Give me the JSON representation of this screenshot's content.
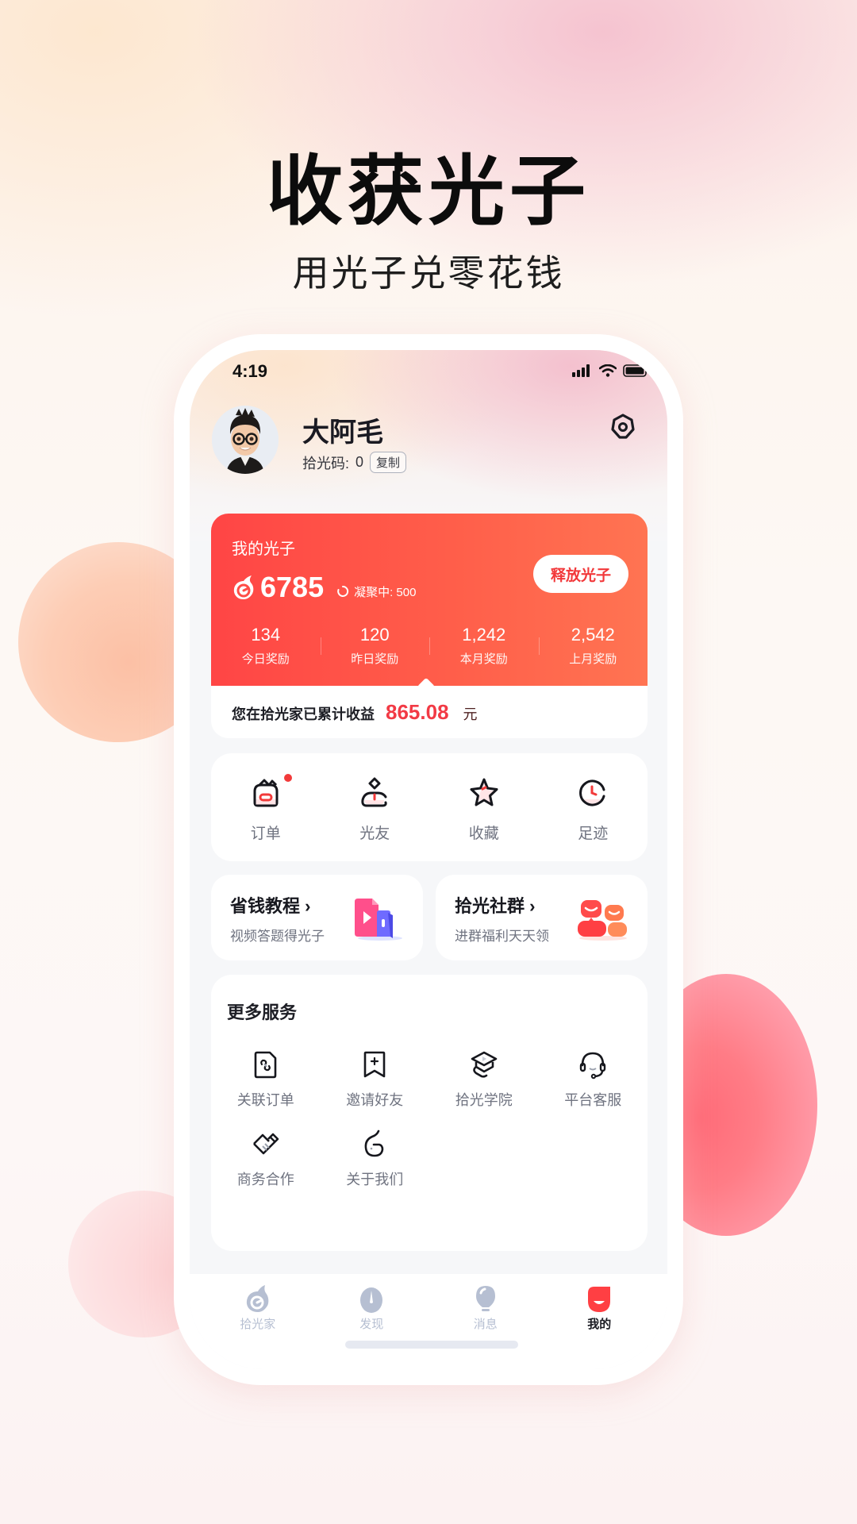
{
  "hero": {
    "title": "收获光子",
    "subtitle": "用光子兑零花钱"
  },
  "status_bar": {
    "time": "4:19",
    "icons": [
      "signal-icon",
      "wifi-icon",
      "battery-icon"
    ]
  },
  "profile": {
    "name": "大阿毛",
    "code_label": "拾光码:",
    "code_value": "0",
    "copy_label": "复制",
    "settings_icon": "settings-icon"
  },
  "photon_card": {
    "label": "我的光子",
    "amount": "6785",
    "pending_label": "凝聚中: 500",
    "release_button": "释放光子",
    "stats": [
      {
        "value": "134",
        "label": "今日奖励"
      },
      {
        "value": "120",
        "label": "昨日奖励"
      },
      {
        "value": "1,242",
        "label": "本月奖励"
      },
      {
        "value": "2,542",
        "label": "上月奖励"
      }
    ],
    "earnings_label": "您在拾光家已累计收益",
    "earnings_value": "865.08",
    "earnings_unit": "元"
  },
  "quick_actions": [
    {
      "label": "订单",
      "icon": "order-icon",
      "badge": true
    },
    {
      "label": "光友",
      "icon": "friends-icon",
      "badge": false
    },
    {
      "label": "收藏",
      "icon": "star-icon",
      "badge": false
    },
    {
      "label": "足迹",
      "icon": "clock-icon",
      "badge": false
    }
  ],
  "promos": [
    {
      "title": "省钱教程",
      "chevron": "›",
      "subtitle": "视频答题得光子",
      "icon": "video-tutorial-icon"
    },
    {
      "title": "拾光社群",
      "chevron": "›",
      "subtitle": "进群福利天天领",
      "icon": "community-icon"
    }
  ],
  "services": {
    "title": "更多服务",
    "items": [
      {
        "label": "关联订单",
        "icon": "link-order-icon"
      },
      {
        "label": "邀请好友",
        "icon": "invite-friend-icon"
      },
      {
        "label": "拾光学院",
        "icon": "academy-icon"
      },
      {
        "label": "平台客服",
        "icon": "headset-icon"
      },
      {
        "label": "商务合作",
        "icon": "handshake-icon"
      },
      {
        "label": "关于我们",
        "icon": "about-us-icon"
      }
    ]
  },
  "tabbar": {
    "tabs": [
      {
        "label": "拾光家",
        "icon": "home-logo-icon",
        "active": false
      },
      {
        "label": "发现",
        "icon": "discover-icon",
        "active": false
      },
      {
        "label": "消息",
        "icon": "lightbulb-message-icon",
        "active": false
      },
      {
        "label": "我的",
        "icon": "profile-tab-icon",
        "active": true
      }
    ]
  },
  "colors": {
    "accent": "#f23a3a",
    "card_gradient_start": "#ff4545",
    "card_gradient_end": "#ff7452",
    "tab_inactive": "#b6bfd2",
    "label_gray": "#6f7380"
  }
}
